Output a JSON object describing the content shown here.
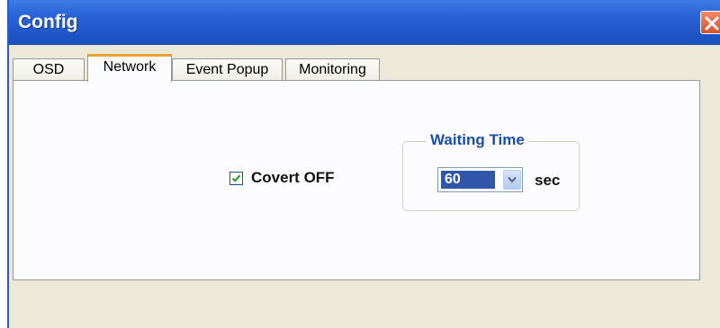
{
  "window": {
    "title": "Config",
    "close_icon": "close-icon"
  },
  "tabs": [
    {
      "label": "OSD",
      "active": false
    },
    {
      "label": "Network",
      "active": true
    },
    {
      "label": "Event Popup",
      "active": false
    },
    {
      "label": "Monitoring",
      "active": false
    }
  ],
  "network": {
    "covert": {
      "label": "Covert OFF",
      "checked": true
    },
    "waiting_time": {
      "legend": "Waiting Time",
      "value": "60",
      "unit": "sec"
    }
  },
  "colors": {
    "titlebar": "#2a63d8",
    "tab_highlight": "#e8a035",
    "legend_text": "#1a4ea8",
    "selection": "#2f56a8",
    "close_button": "#d9522c"
  }
}
